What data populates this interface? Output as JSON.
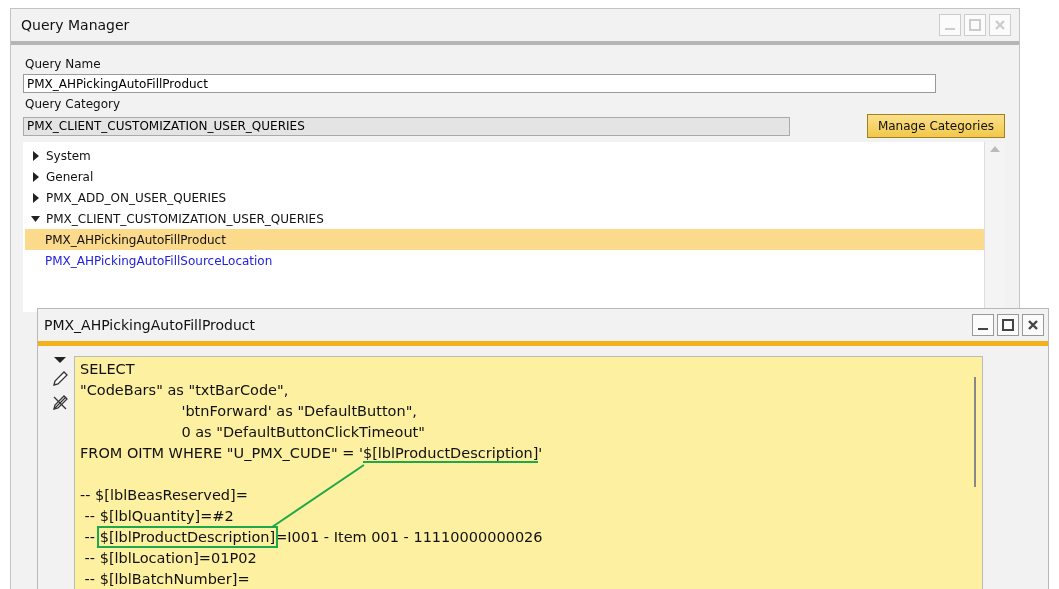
{
  "window": {
    "title": "Query Manager"
  },
  "query_name": {
    "label": "Query Name",
    "value": "PMX_AHPickingAutoFillProduct"
  },
  "query_category": {
    "label": "Query Category",
    "value": "PMX_CLIENT_CUSTOMIZATION_USER_QUERIES",
    "button": "Manage Categories"
  },
  "tree": [
    {
      "label": "System",
      "expanded": false
    },
    {
      "label": "General",
      "expanded": false
    },
    {
      "label": "PMX_ADD_ON_USER_QUERIES",
      "expanded": false
    },
    {
      "label": "PMX_CLIENT_CUSTOMIZATION_USER_QUERIES",
      "expanded": true,
      "children": [
        {
          "label": "PMX_AHPickingAutoFillProduct",
          "selected": true
        },
        {
          "label": "PMX_AHPickingAutoFillSourceLocation",
          "selected": false
        }
      ]
    }
  ],
  "editor": {
    "title": "PMX_AHPickingAutoFillProduct",
    "lines": [
      {
        "kind": "text",
        "parts": [
          {
            "text": "SELECT"
          }
        ]
      },
      {
        "kind": "text",
        "parts": [
          {
            "text": "\"CodeBars\" as \"txtBarCode\","
          }
        ]
      },
      {
        "kind": "text",
        "parts": [
          {
            "text": "                      'btnForward' as \"DefaultButton\","
          }
        ]
      },
      {
        "kind": "text",
        "parts": [
          {
            "text": "                      0 as \"DefaultButtonClickTimeout\""
          }
        ]
      },
      {
        "kind": "text",
        "parts": [
          {
            "text": "FROM OITM WHERE \"U_PMX_CUDE\" = '"
          },
          {
            "text": "$[lblProductDescription]",
            "kind": "underline"
          },
          {
            "text": "'"
          }
        ]
      },
      {
        "kind": "blank"
      },
      {
        "kind": "text",
        "parts": [
          {
            "text": "-- $[lblBeasReserved]="
          }
        ]
      },
      {
        "kind": "text",
        "parts": [
          {
            "text": " -- $[lblQuantity]=#2"
          }
        ]
      },
      {
        "kind": "text",
        "parts": [
          {
            "text": " -- "
          },
          {
            "text": "$[lblProductDescription]",
            "kind": "box"
          },
          {
            "text": "=I001 - Item 001 - 11110000000026"
          }
        ]
      },
      {
        "kind": "text",
        "parts": [
          {
            "text": " -- $[lblLocation]=01P02"
          }
        ]
      },
      {
        "kind": "text",
        "parts": [
          {
            "text": " -- $[lblBatchNumber]="
          }
        ]
      }
    ]
  }
}
